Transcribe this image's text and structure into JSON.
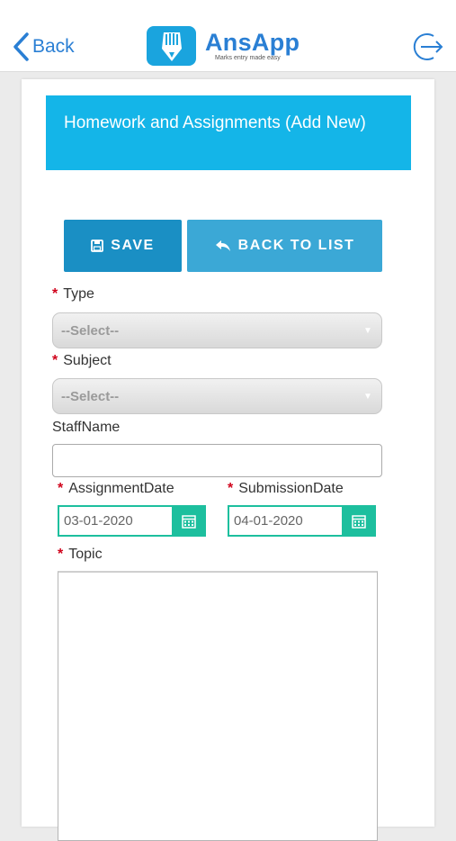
{
  "header": {
    "back_label": "Back",
    "app_name": "AnsApp",
    "tagline": "Marks entry made easy"
  },
  "page": {
    "title": "Homework and Assignments (Add New)"
  },
  "actions": {
    "save_label": "SAVE",
    "back_to_list_label": "BACK TO LIST"
  },
  "form": {
    "required_mark": "*",
    "type": {
      "label": "Type",
      "value": "--Select--"
    },
    "subject": {
      "label": "Subject",
      "value": "--Select--"
    },
    "staff_name": {
      "label": "StaffName",
      "value": ""
    },
    "assignment_date": {
      "label": "AssignmentDate",
      "value": "03-01-2020"
    },
    "submission_date": {
      "label": "SubmissionDate",
      "value": "04-01-2020"
    },
    "topic": {
      "label": "Topic",
      "value": ""
    }
  },
  "colors": {
    "header_bg": "#14b5e8",
    "save_btn": "#1a8fc4",
    "back_btn": "#3ba8d6",
    "date_accent": "#1dbf9e",
    "required": "#d0021b",
    "link_blue": "#2a7fd4"
  },
  "icons": {
    "back": "chevron-left-icon",
    "logo": "pencil-hand-icon",
    "logout": "logout-arrow-icon",
    "save": "floppy-disk-icon",
    "back_to_list": "reply-arrow-icon",
    "calendar": "calendar-icon",
    "dropdown": "caret-down-icon"
  }
}
